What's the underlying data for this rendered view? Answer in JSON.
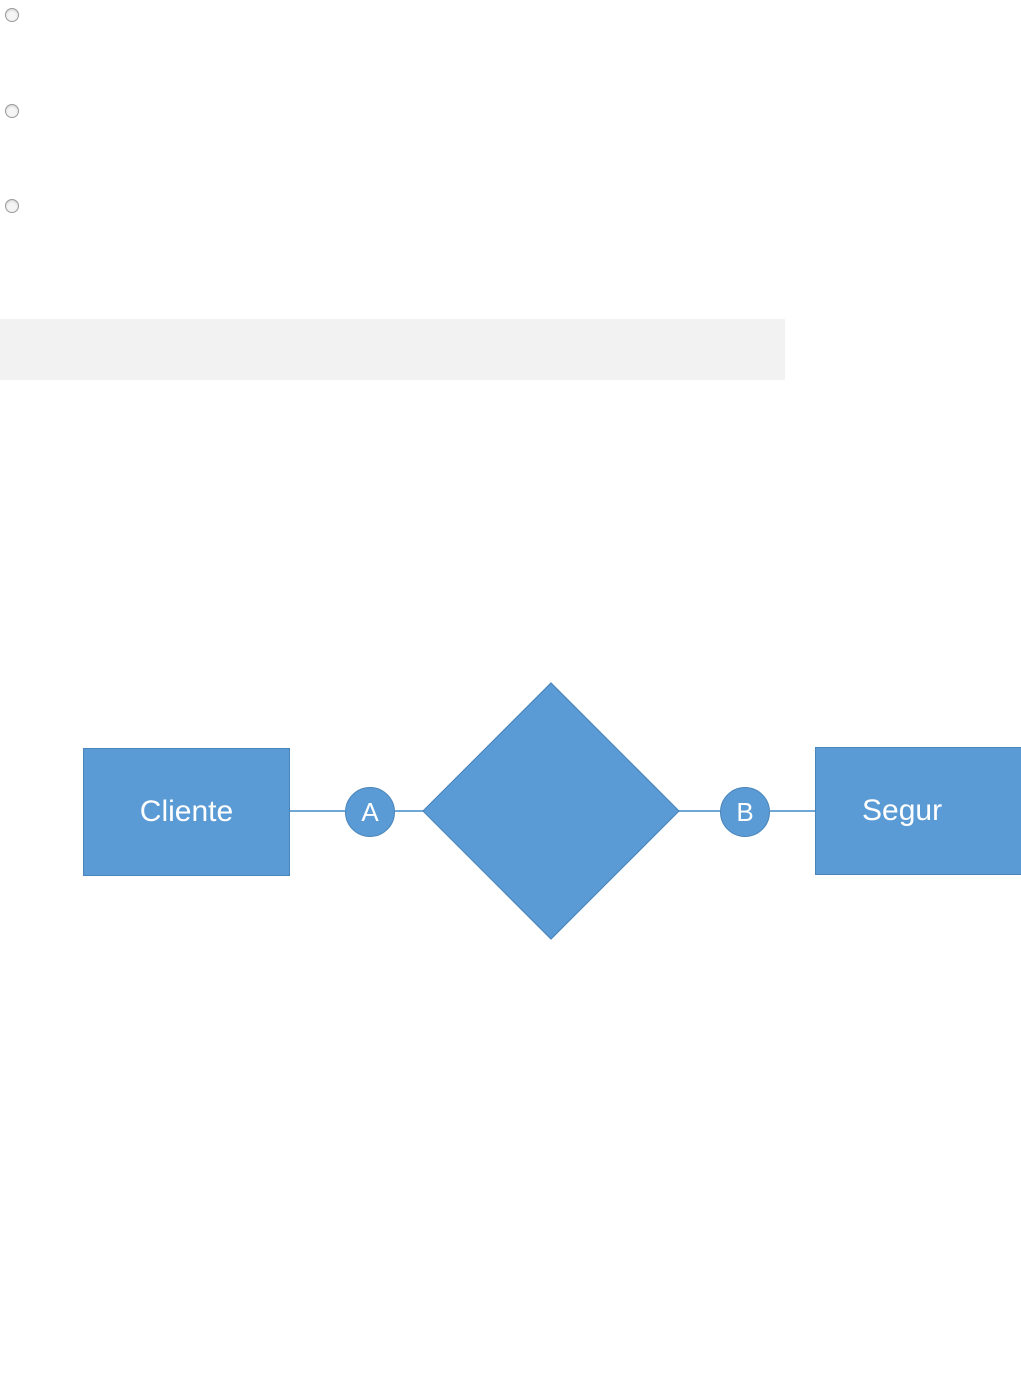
{
  "options": {
    "radio_count": 3
  },
  "er": {
    "left_entity_label": "Cliente",
    "right_entity_label": "Segur",
    "left_cardinality_label": "A",
    "right_cardinality_label": "B"
  }
}
